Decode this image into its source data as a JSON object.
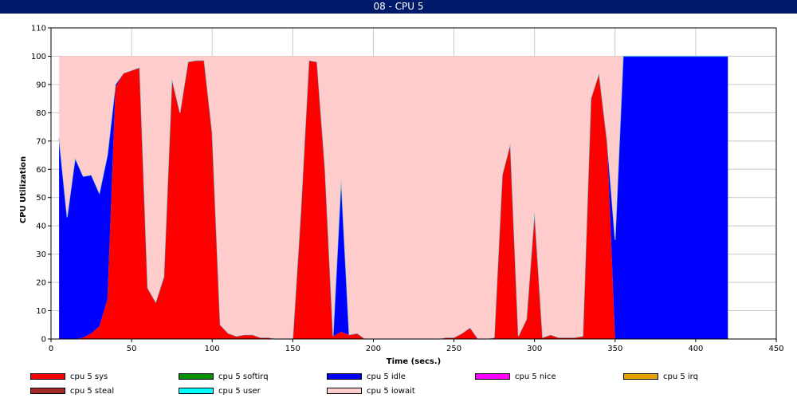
{
  "window": {
    "title": "08 - CPU 5"
  },
  "chart_data": {
    "type": "area",
    "stacked": true,
    "xlabel": "Time (secs.)",
    "ylabel": "CPU Utilization",
    "xlim": [
      0,
      450
    ],
    "ylim": [
      0,
      110
    ],
    "xticks": [
      0,
      50,
      100,
      150,
      200,
      250,
      300,
      350,
      400,
      450
    ],
    "yticks": [
      0,
      10,
      20,
      30,
      40,
      50,
      60,
      70,
      80,
      90,
      100,
      110
    ],
    "grid": true,
    "legend_position": "bottom",
    "x": [
      5,
      10,
      15,
      20,
      25,
      30,
      35,
      40,
      45,
      50,
      55,
      60,
      65,
      70,
      75,
      80,
      85,
      90,
      95,
      100,
      105,
      110,
      115,
      120,
      125,
      130,
      135,
      140,
      145,
      150,
      155,
      160,
      165,
      170,
      175,
      180,
      185,
      190,
      195,
      200,
      205,
      210,
      215,
      220,
      225,
      230,
      235,
      240,
      245,
      250,
      255,
      260,
      265,
      270,
      275,
      280,
      285,
      290,
      295,
      300,
      305,
      310,
      315,
      320,
      325,
      330,
      335,
      340,
      345,
      350,
      355,
      360,
      365,
      370,
      375,
      380,
      385,
      390,
      395,
      400,
      405,
      410,
      415,
      420
    ],
    "series": [
      {
        "name": "cpu 5 sys",
        "color": "#ff0000",
        "values": [
          0,
          0,
          0,
          0.5,
          2,
          4.5,
          14,
          89,
          94,
          95,
          96,
          18,
          13,
          22,
          92,
          80,
          98,
          98.5,
          98.5,
          73,
          5,
          2,
          1,
          1.5,
          1.5,
          0.5,
          0.5,
          0,
          0,
          0,
          45,
          98.5,
          98,
          60,
          1,
          2.5,
          1.5,
          2,
          0,
          0,
          0,
          0,
          0,
          0,
          0,
          0,
          0,
          0,
          0.5,
          0.5,
          2,
          4,
          0,
          0,
          0.5,
          58,
          69,
          1,
          7,
          45,
          0.5,
          1.5,
          0.5,
          0.5,
          0.5,
          1,
          85,
          94,
          70,
          0,
          0,
          0,
          0,
          0,
          0,
          0,
          0,
          0,
          0,
          0,
          0,
          0,
          0,
          0
        ]
      },
      {
        "name": "cpu 5 softirq",
        "color": "#009000",
        "values": [
          0,
          0,
          0,
          0,
          0,
          0,
          0,
          0,
          0,
          0,
          0,
          0,
          0,
          0,
          0,
          0,
          0,
          0,
          0,
          0,
          0,
          0,
          0,
          0,
          0,
          0,
          0,
          0,
          0,
          0,
          0,
          0,
          0,
          0,
          0,
          0,
          0,
          0,
          0,
          0,
          0,
          0,
          0,
          0,
          0,
          0,
          0,
          0,
          0,
          0,
          0,
          0,
          0,
          0,
          0,
          0,
          0,
          0,
          0,
          0,
          0,
          0,
          0,
          0,
          0,
          0,
          0,
          0,
          0,
          0,
          0,
          0,
          0,
          0,
          0,
          0,
          0,
          0,
          0,
          0,
          0,
          0,
          0,
          0
        ]
      },
      {
        "name": "cpu 5 idle",
        "color": "#0000ff",
        "values": [
          71,
          43,
          64,
          57,
          56,
          47,
          51,
          1,
          0,
          0,
          0,
          0,
          0,
          0,
          0,
          0,
          0,
          0,
          0,
          0,
          0,
          0,
          0,
          0,
          0,
          0,
          0,
          0,
          0,
          0,
          0,
          0,
          0,
          0,
          0,
          54,
          0,
          0,
          0,
          0,
          0,
          0,
          0,
          0,
          0,
          0,
          0,
          0,
          0,
          0,
          0,
          0,
          0,
          0,
          0,
          0,
          0,
          0,
          0,
          0,
          0,
          0,
          0,
          0,
          0,
          0,
          0,
          0,
          0,
          35,
          100,
          100,
          100,
          100,
          100,
          100,
          100,
          100,
          100,
          100,
          100,
          100,
          100,
          100
        ]
      },
      {
        "name": "cpu 5 nice",
        "color": "#ff00ff",
        "values": [
          0,
          0,
          0,
          0,
          0,
          0,
          0,
          0,
          0,
          0,
          0,
          0,
          0,
          0,
          0,
          0,
          0,
          0,
          0,
          0,
          0,
          0,
          0,
          0,
          0,
          0,
          0,
          0,
          0,
          0,
          0,
          0,
          0,
          0,
          0,
          0,
          0,
          0,
          0,
          0,
          0,
          0,
          0,
          0,
          0,
          0,
          0,
          0,
          0,
          0,
          0,
          0,
          0,
          0,
          0,
          0,
          0,
          0,
          0,
          0,
          0,
          0,
          0,
          0,
          0,
          0,
          0,
          0,
          0,
          0,
          0,
          0,
          0,
          0,
          0,
          0,
          0,
          0,
          0,
          0,
          0,
          0,
          0,
          0
        ]
      },
      {
        "name": "cpu 5 irq",
        "color": "#e8a000",
        "values": [
          0,
          0,
          0,
          0,
          0,
          0,
          0,
          0,
          0,
          0,
          0,
          0,
          0,
          0,
          0,
          0,
          0,
          0,
          0,
          0,
          0,
          0,
          0,
          0,
          0,
          0,
          0,
          0,
          0,
          0,
          0,
          0,
          0,
          0,
          0,
          0,
          0,
          0,
          0,
          0,
          0,
          0,
          0,
          0,
          0,
          0,
          0,
          0,
          0,
          0,
          0,
          0,
          0,
          0,
          0,
          0,
          0,
          0,
          0,
          0,
          0,
          0,
          0,
          0,
          0,
          0,
          0,
          0,
          0,
          0,
          0,
          0,
          0,
          0,
          0,
          0,
          0,
          0,
          0,
          0,
          0,
          0,
          0,
          0
        ]
      },
      {
        "name": "cpu 5 steal",
        "color": "#a52a2a",
        "values": [
          0,
          0,
          0,
          0,
          0,
          0,
          0,
          0,
          0,
          0,
          0,
          0,
          0,
          0,
          0,
          0,
          0,
          0,
          0,
          0,
          0,
          0,
          0,
          0,
          0,
          0,
          0,
          0,
          0,
          0,
          0,
          0,
          0,
          0,
          0,
          0,
          0,
          0,
          0,
          0,
          0,
          0,
          0,
          0,
          0,
          0,
          0,
          0,
          0,
          0,
          0,
          0,
          0,
          0,
          0,
          0,
          0,
          0,
          0,
          0,
          0,
          0,
          0,
          0,
          0,
          0,
          0,
          0,
          0,
          0,
          0,
          0,
          0,
          0,
          0,
          0,
          0,
          0,
          0,
          0,
          0,
          0,
          0,
          0
        ]
      },
      {
        "name": "cpu 5 user",
        "color": "#00ffff",
        "values": [
          0,
          0,
          0,
          0,
          0,
          0,
          0,
          0,
          0,
          0,
          0,
          0,
          0,
          0,
          0,
          0,
          0,
          0,
          0,
          0,
          0,
          0,
          0,
          0,
          0,
          0,
          0,
          0,
          0,
          0,
          0,
          0,
          0,
          0,
          0,
          0,
          0,
          0,
          0,
          0,
          0,
          0,
          0,
          0,
          0,
          0,
          0,
          0,
          0,
          0,
          0,
          0,
          0,
          0,
          0,
          0,
          0,
          0,
          0,
          0,
          0,
          0,
          0,
          0,
          0,
          0,
          0,
          0,
          0,
          0,
          0,
          0,
          0,
          0,
          0,
          0,
          0,
          0,
          0,
          0,
          0,
          0,
          0,
          0
        ]
      },
      {
        "name": "cpu 5 iowait",
        "color": "#ffcccc",
        "values": [
          29,
          57,
          36,
          42.5,
          42,
          48.5,
          35,
          10,
          6,
          5,
          4,
          82,
          87,
          78,
          8,
          20,
          2,
          1.5,
          1.5,
          27,
          95,
          98,
          99,
          98.5,
          98.5,
          99.5,
          99.5,
          100,
          100,
          100,
          55,
          1.5,
          2,
          40,
          99,
          43.5,
          98.5,
          98,
          100,
          100,
          100,
          100,
          100,
          100,
          100,
          100,
          100,
          100,
          99.5,
          99.5,
          98,
          96,
          100,
          100,
          99.5,
          42,
          31,
          99,
          93,
          55,
          99.5,
          98.5,
          99.5,
          99.5,
          99.5,
          99,
          15,
          6,
          30,
          65,
          0,
          0,
          0,
          0,
          0,
          0,
          0,
          0,
          0,
          0,
          0,
          0,
          0,
          0
        ]
      }
    ]
  }
}
